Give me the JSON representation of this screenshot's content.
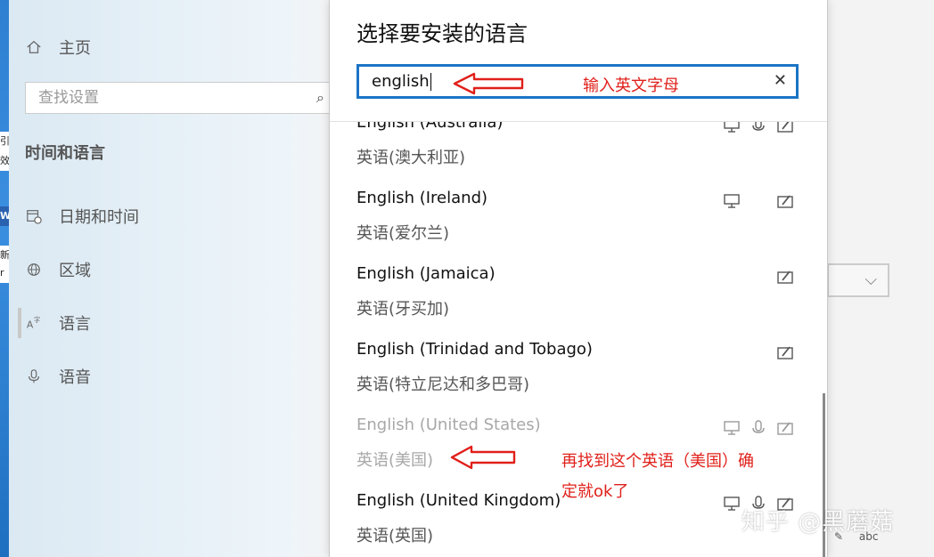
{
  "settings": {
    "home_label": "主页",
    "search_placeholder": "查找设置",
    "section_title": "时间和语言",
    "nav": [
      {
        "label": "日期和时间",
        "icon": "calendar-clock-icon"
      },
      {
        "label": "区域",
        "icon": "globe-icon"
      },
      {
        "label": "语言",
        "icon": "language-icon"
      },
      {
        "label": "语音",
        "icon": "microphone-icon"
      }
    ]
  },
  "desktop_strip": {
    "fragments": [
      "引",
      "效",
      "W",
      "新",
      "r"
    ]
  },
  "dialog": {
    "title": "选择要安装的语言",
    "search_value": "english",
    "languages": [
      {
        "english": "English (Australia)",
        "chinese": "英语(澳大利亚)",
        "features": [
          "display-icon",
          "microphone-icon",
          "handwriting-icon"
        ]
      },
      {
        "english": "English (Ireland)",
        "chinese": "英语(爱尔兰)",
        "features": [
          "display-icon",
          "handwriting-icon"
        ]
      },
      {
        "english": "English (Jamaica)",
        "chinese": "英语(牙买加)",
        "features": [
          "handwriting-icon"
        ]
      },
      {
        "english": "English (Trinidad and Tobago)",
        "chinese": "英语(特立尼达和多巴哥)",
        "features": [
          "handwriting-icon"
        ]
      },
      {
        "english": "English (United States)",
        "chinese": "英语(美国)",
        "features": [
          "display-icon",
          "microphone-icon",
          "handwriting-icon"
        ],
        "dimmed": true
      },
      {
        "english": "English (United Kingdom)",
        "chinese": "英语(英国)",
        "features": [
          "display-icon",
          "microphone-icon",
          "handwriting-icon"
        ]
      }
    ]
  },
  "annotations": {
    "input_note": "输入英文字母",
    "select_note_line1": "再找到这个英语（美国）确",
    "select_note_line2": "定就ok了"
  },
  "watermark": "知乎 @黑蘑菇",
  "corner_badge": "abc",
  "colors": {
    "accent": "#1b74c5",
    "annotation": "#e0201a"
  }
}
